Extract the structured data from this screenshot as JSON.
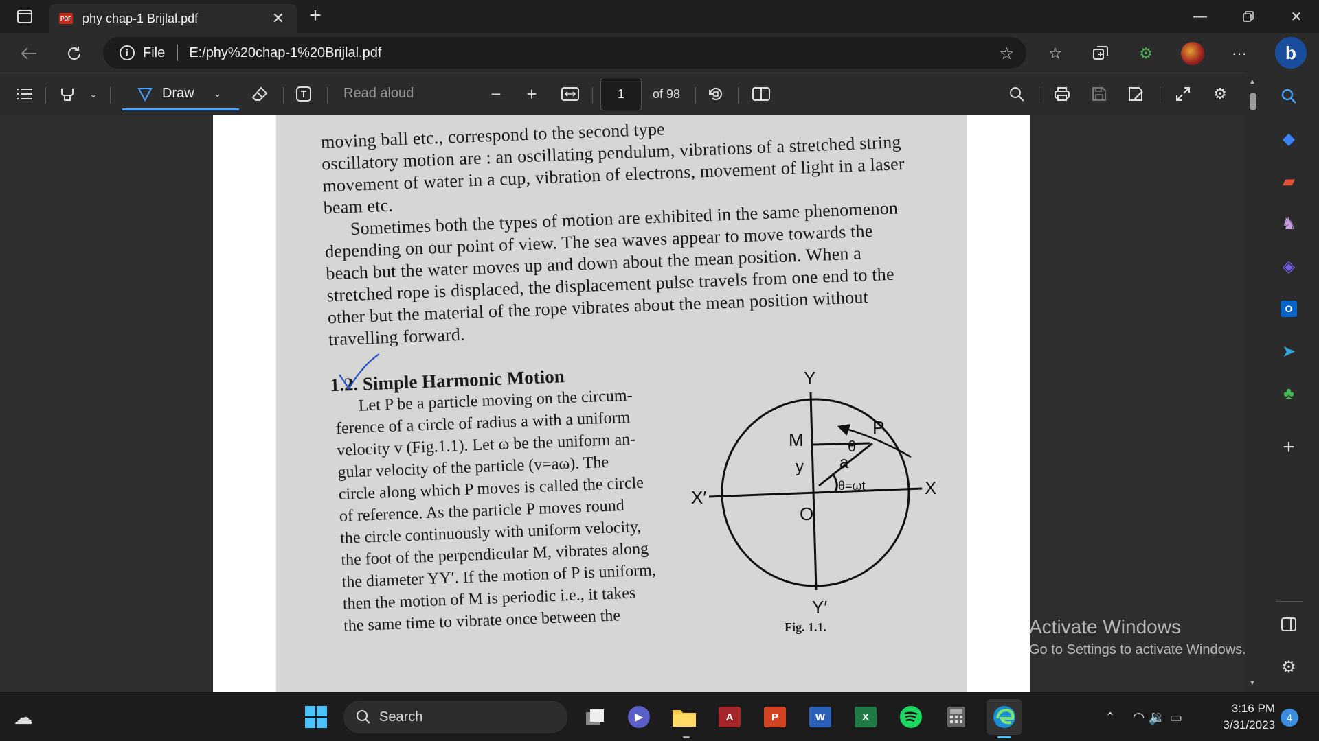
{
  "browser": {
    "tab_title": "phy chap-1 Brijlal.pdf",
    "tab_icon_text": "PDF",
    "address_scheme": "File",
    "address_url": "E:/phy%20chap-1%20Brijlal.pdf"
  },
  "pdf_toolbar": {
    "draw_label": "Draw",
    "read_aloud_label": "Read aloud",
    "current_page": "1",
    "page_count_label": "of 98"
  },
  "document": {
    "lines": [
      "moving ball etc., correspond to the second type",
      "oscillatory motion are : an oscillating pendulum, vibrations of a stretched string",
      "movement of water in a cup, vibration of electrons, movement of light in a laser",
      "beam etc.",
      "Sometimes both the types of motion are exhibited in the same phenomenon",
      "depending on our point of view. The sea waves appear to move towards the",
      "beach but the water moves up and down about the mean position. When a",
      "stretched rope is displaced, the displacement pulse travels from one end to the",
      "other but the material of the rope vibrates about the mean position without",
      "travelling forward."
    ],
    "section_heading": "1.2. Simple Harmonic Motion",
    "column_lines": [
      "Let P be a particle moving on the circum-",
      "ference of a circle of radius a with a uniform",
      "velocity v (Fig.1.1). Let ω be the uniform an-",
      "gular velocity of the particle (v=aω). The",
      "circle along which P moves is called the circle",
      "of reference. As the particle P moves round",
      "the circle continuously with uniform velocity,",
      "the foot of the perpendicular M, vibrates along",
      "the diameter YY′. If the motion of P is uniform,",
      "then the motion of M is periodic i.e., it takes",
      "the same time to vibrate once between the"
    ],
    "figure_labels": {
      "y_top": "Y",
      "y_bottom": "Y′",
      "x_right": "X",
      "x_left": "X′",
      "origin": "O",
      "point_p": "P",
      "point_m": "M",
      "radius": "a",
      "y_label": "y",
      "angle": "θ",
      "angle_eq": "θ=ωt"
    },
    "figure_caption": "Fig. 1.1."
  },
  "watermark": {
    "line1": "Activate Windows",
    "line2": "Go to Settings to activate Windows."
  },
  "taskbar": {
    "search_label": "Search",
    "time": "3:16 PM",
    "date": "3/31/2023",
    "notification_count": "4"
  }
}
